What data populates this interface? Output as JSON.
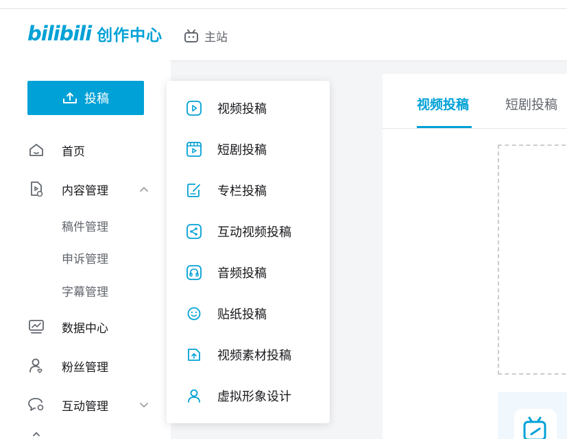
{
  "header": {
    "logo_mark": "bilibili",
    "logo_text": "创作中心",
    "main_site_label": "主站"
  },
  "sidebar": {
    "upload_label": "投稿",
    "items": [
      {
        "label": "首页",
        "icon": "home-icon"
      },
      {
        "label": "内容管理",
        "icon": "content-doc-icon",
        "expanded": true
      },
      {
        "label": "数据中心",
        "icon": "chart-icon"
      },
      {
        "label": "粉丝管理",
        "icon": "fans-icon"
      },
      {
        "label": "互动管理",
        "icon": "chat-icon",
        "expanded": false
      }
    ],
    "content_sub_items": [
      "稿件管理",
      "申诉管理",
      "字幕管理"
    ]
  },
  "upload_menu": {
    "items": [
      {
        "label": "视频投稿",
        "icon": "video-play-icon"
      },
      {
        "label": "短剧投稿",
        "icon": "short-drama-icon"
      },
      {
        "label": "专栏投稿",
        "icon": "article-edit-icon"
      },
      {
        "label": "互动视频投稿",
        "icon": "interactive-share-icon"
      },
      {
        "label": "音频投稿",
        "icon": "headphones-icon"
      },
      {
        "label": "贴纸投稿",
        "icon": "sticker-smile-icon"
      },
      {
        "label": "视频素材投稿",
        "icon": "material-upload-icon"
      },
      {
        "label": "虚拟形象设计",
        "icon": "avatar-user-icon"
      }
    ]
  },
  "main": {
    "tabs": [
      {
        "label": "视频投稿",
        "active": true
      },
      {
        "label": "短剧投稿",
        "active": false
      }
    ]
  },
  "colors": {
    "accent": "#00a1d6",
    "text": "#18191c",
    "muted": "#61666d"
  }
}
